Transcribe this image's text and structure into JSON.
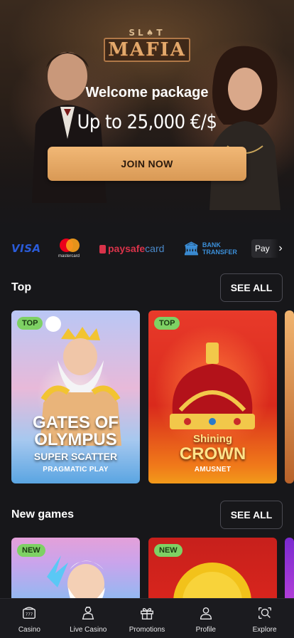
{
  "hero": {
    "logo_small": "SL♠T",
    "logo_big": "MAFIA",
    "title": "Welcome package",
    "subtitle": "Up to 25,000 €/$",
    "cta": "JOIN NOW"
  },
  "payments": {
    "visa": "VISA",
    "mastercard": "mastercard",
    "paysafe_a": "paysafe",
    "paysafe_b": "card",
    "bank_line1": "BANK",
    "bank_line2": "TRANSFER",
    "apple": "Pay"
  },
  "sections": {
    "top": {
      "title": "Top",
      "see_all": "SEE ALL",
      "games": [
        {
          "badge": "TOP",
          "title_line1": "GATES OF",
          "title_line2": "OLYMPUS",
          "title_line3": "SUPER SCATTER",
          "provider": "PRAGMATIC PLAY"
        },
        {
          "badge": "TOP",
          "title_line1": "Shining",
          "title_line2": "CROWN",
          "provider": "AMUSNET"
        }
      ]
    },
    "new_games": {
      "title": "New games",
      "see_all": "SEE ALL",
      "games": [
        {
          "badge": "NEW"
        },
        {
          "badge": "NEW"
        }
      ]
    }
  },
  "nav": [
    {
      "label": "Casino",
      "icon": "slot-machine-icon"
    },
    {
      "label": "Live Casino",
      "icon": "dealer-icon"
    },
    {
      "label": "Promotions",
      "icon": "gift-icon"
    },
    {
      "label": "Profile",
      "icon": "user-icon"
    },
    {
      "label": "Explore",
      "icon": "search-explore-icon"
    }
  ],
  "colors": {
    "background": "#17171a",
    "cta": "#e4a666",
    "badge": "#7ed164"
  }
}
